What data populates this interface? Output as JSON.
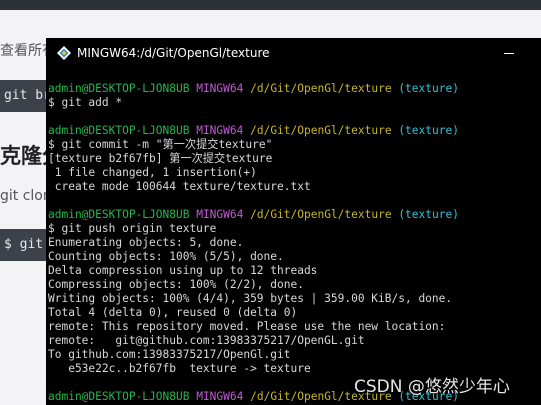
{
  "background_page": {
    "line1": "查看所有",
    "code1": "git br",
    "heading": "克隆分",
    "line2": "git clon",
    "code2": "$ git"
  },
  "terminal": {
    "title": "MINGW64:/d/Git/OpenGl/texture",
    "prompt": {
      "user": "admin@DESKTOP-LJON8UB",
      "system": "MINGW64",
      "path": "/d/Git/OpenGl/texture",
      "branch": "(texture)"
    },
    "blocks": [
      {
        "command": "$ git add *",
        "output": []
      },
      {
        "command": "$ git commit -m \"第一次提交texture\"",
        "output": [
          "[texture b2f67fb] 第一次提交texture",
          " 1 file changed, 1 insertion(+)",
          " create mode 100644 texture/texture.txt"
        ]
      },
      {
        "command": "$ git push origin texture",
        "output": [
          "Enumerating objects: 5, done.",
          "Counting objects: 100% (5/5), done.",
          "Delta compression using up to 12 threads",
          "Compressing objects: 100% (2/2), done.",
          "Writing objects: 100% (4/4), 359 bytes | 359.00 KiB/s, done.",
          "Total 4 (delta 0), reused 0 (delta 0)",
          "remote: This repository moved. Please use the new location:",
          "remote:   git@github.com:13983375217/OpenGL.git",
          "To github.com:13983375217/OpenGl.git",
          "   e53e22c..b2f67fb  texture -> texture"
        ]
      }
    ]
  },
  "watermark": "CSDN @悠然少年心",
  "colors": {
    "user": "#28b54b",
    "system": "#c15ad4",
    "path": "#c6b62a",
    "branch": "#2ec1d8"
  }
}
